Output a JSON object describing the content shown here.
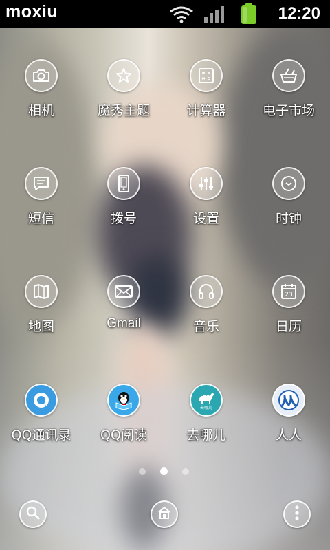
{
  "status_bar": {
    "carrier": "moxiu",
    "time": "12:20",
    "icons": [
      "wifi-icon",
      "signal-icon",
      "battery-icon"
    ]
  },
  "apps": [
    {
      "label": "相机",
      "icon": "camera-icon"
    },
    {
      "label": "魔秀主题",
      "icon": "star-icon"
    },
    {
      "label": "计算器",
      "icon": "calculator-icon"
    },
    {
      "label": "电子市场",
      "icon": "basket-icon"
    },
    {
      "label": "短信",
      "icon": "message-icon"
    },
    {
      "label": "拨号",
      "icon": "phone-icon"
    },
    {
      "label": "设置",
      "icon": "sliders-icon"
    },
    {
      "label": "时钟",
      "icon": "clock-icon"
    },
    {
      "label": "地图",
      "icon": "map-icon"
    },
    {
      "label": "Gmail",
      "icon": "envelope-icon"
    },
    {
      "label": "音乐",
      "icon": "headphones-icon"
    },
    {
      "label": "日历",
      "icon": "calendar-icon",
      "date_text": "23"
    },
    {
      "label": "QQ通讯录",
      "icon": "qq-contacts-icon"
    },
    {
      "label": "QQ阅读",
      "icon": "qq-reader-icon"
    },
    {
      "label": "去哪儿",
      "icon": "qunar-camel-icon",
      "icon_text": "去哪儿"
    },
    {
      "label": "人人",
      "icon": "renren-icon"
    }
  ],
  "page_indicator": {
    "pages": 3,
    "current": 2
  },
  "dock": [
    {
      "icon": "search-icon"
    },
    {
      "icon": "home-icon"
    },
    {
      "icon": "menu-dots-icon"
    }
  ],
  "colors": {
    "status_bar_bg": "#000000",
    "label_text": "#ffffff",
    "qq_contacts_blue": "#3a9be0",
    "qunar_teal": "#2aa7b0",
    "renren_blue": "#1f5fb5"
  }
}
